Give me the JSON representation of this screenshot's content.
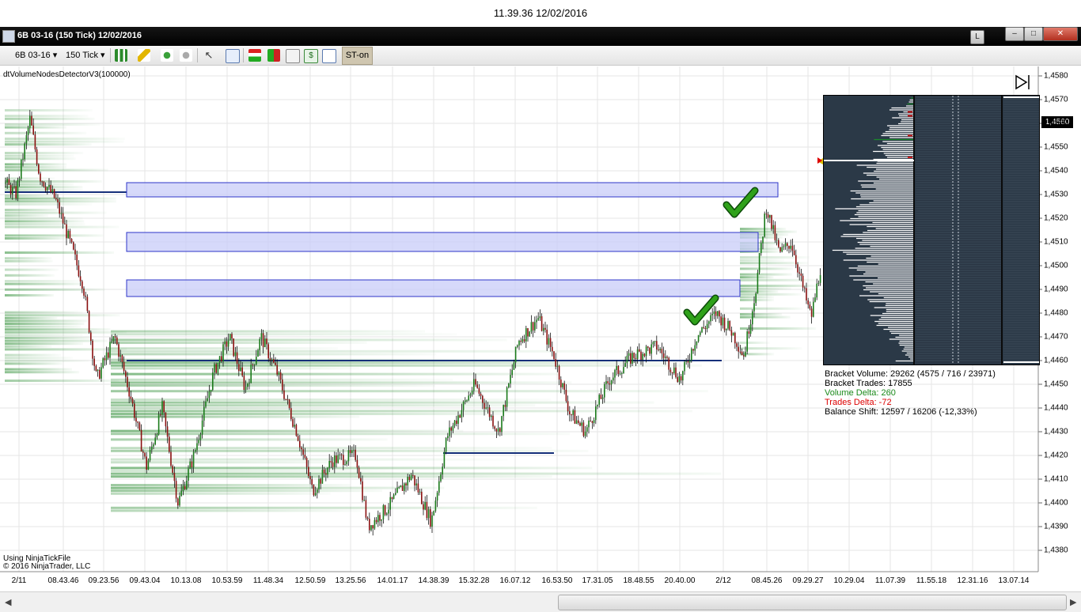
{
  "window": {
    "timestamp": "11.39.36 12/02/2016",
    "title": "6B 03-16 (150 Tick)  12/02/2016",
    "button_l": "L"
  },
  "toolbar": {
    "instrument": "6B 03-16",
    "interval": "150 Tick",
    "st_on": "ST-on",
    "icons": [
      "bar-type-icon",
      "pencil-draw-icon",
      "add-indicator-icon",
      "remove-indicator-icon",
      "cursor-icon",
      "zoom-icon",
      "order-entry-icon",
      "data-box-icon",
      "chart-trader-icon",
      "dollar-icon",
      "properties-icon"
    ]
  },
  "chart": {
    "indicator": "dtVolumeNodesDetectorV3(100000)",
    "footer_tick": "Using NinjaTickFile",
    "footer_copy": "© 2016 NinjaTrader, LLC",
    "current_price": "1,4560",
    "y_labels": [
      "1,4580",
      "1,4570",
      "1,4560",
      "1,4550",
      "1,4540",
      "1,4530",
      "1,4520",
      "1,4510",
      "1,4500",
      "1,4490",
      "1,4480",
      "1,4470",
      "1,4460",
      "1,4450",
      "1,4440",
      "1,4430",
      "1,4420",
      "1,4410",
      "1,4400",
      "1,4390",
      "1,4380"
    ],
    "x_labels": [
      "2/11",
      "08.43.46",
      "09.23.56",
      "09.43.04",
      "10.13.08",
      "10.53.59",
      "11.48.34",
      "12.50.59",
      "13.25.56",
      "14.01.17",
      "14.38.39",
      "15.32.28",
      "16.07.12",
      "16.53.50",
      "17.31.05",
      "18.48.55",
      "20.40.00",
      "2/12",
      "08.45.26",
      "09.29.27",
      "10.29.04",
      "11.07.39",
      "11.55.18",
      "12.31.16",
      "13.07.14"
    ],
    "zones": [
      {
        "low": 1.4529,
        "high": 1.4535,
        "label": "node-zone-1"
      },
      {
        "low": 1.4506,
        "high": 1.4514,
        "label": "node-zone-2"
      },
      {
        "low": 1.4487,
        "high": 1.4494,
        "label": "node-zone-3"
      }
    ],
    "colors": {
      "zone_fill": "#c8ccf8",
      "zone_border": "#2d35c8",
      "volume_green": "#0a7a12",
      "check_green": "#2fa11a",
      "poc_line": "#16307a"
    }
  },
  "stats": {
    "bracket_volume": "Bracket Volume: 29262 (4575 / 716 / 23971)",
    "bracket_trades": "Bracket Trades: 17855",
    "volume_delta": "Volume Delta: 260",
    "trades_delta": "Trades Delta: -72",
    "balance_shift": "Balance Shift: 12597 / 16206 (-12,33%)"
  }
}
